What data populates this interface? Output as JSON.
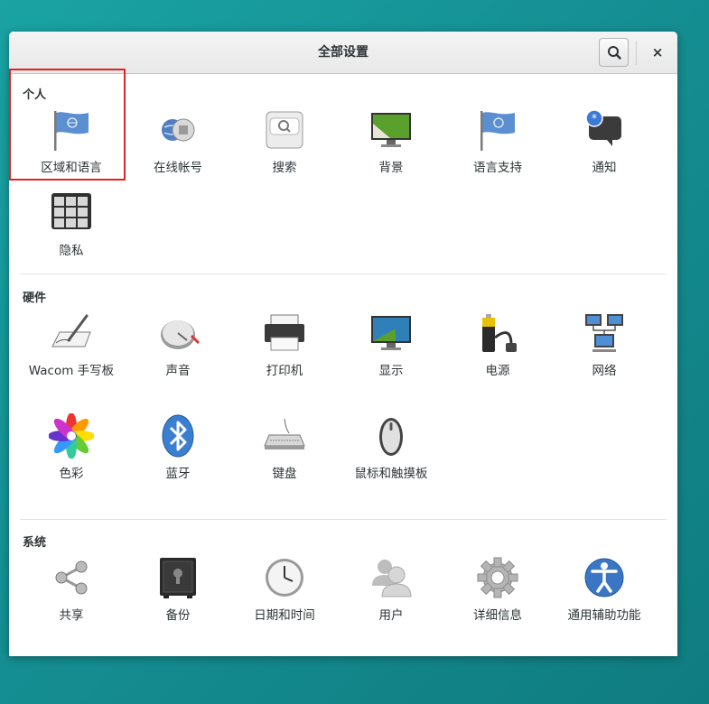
{
  "window": {
    "title": "全部设置"
  },
  "sections": {
    "personal": {
      "title": "个人",
      "items": [
        "区域和语言",
        "在线帐号",
        "搜索",
        "背景",
        "语言支持",
        "通知",
        "隐私"
      ]
    },
    "hardware": {
      "title": "硬件",
      "items": [
        "Wacom 手写板",
        "声音",
        "打印机",
        "显示",
        "电源",
        "网络",
        "色彩",
        "蓝牙",
        "键盘",
        "鼠标和触摸板"
      ]
    },
    "system": {
      "title": "系统",
      "items": [
        "共享",
        "备份",
        "日期和时间",
        "用户",
        "详细信息",
        "通用辅助功能"
      ]
    }
  },
  "icons": {
    "header": [
      "search-icon",
      "close-icon"
    ],
    "personal": [
      "flag-icon",
      "online-accounts-icon",
      "search-icon",
      "background-icon",
      "language-flag-icon",
      "notification-icon",
      "privacy-lock-icon"
    ],
    "hardware": [
      "wacom-tablet-icon",
      "sound-icon",
      "printer-icon",
      "display-icon",
      "power-icon",
      "network-icon",
      "color-icon",
      "bluetooth-icon",
      "keyboard-icon",
      "mouse-icon"
    ],
    "system": [
      "share-icon",
      "backup-safe-icon",
      "clock-icon",
      "users-icon",
      "details-gear-icon",
      "accessibility-icon"
    ]
  },
  "colors": {
    "accent": "#3465a4",
    "highlight": "#e02424",
    "background": "#1aa3a3"
  },
  "close_glyph": "×"
}
